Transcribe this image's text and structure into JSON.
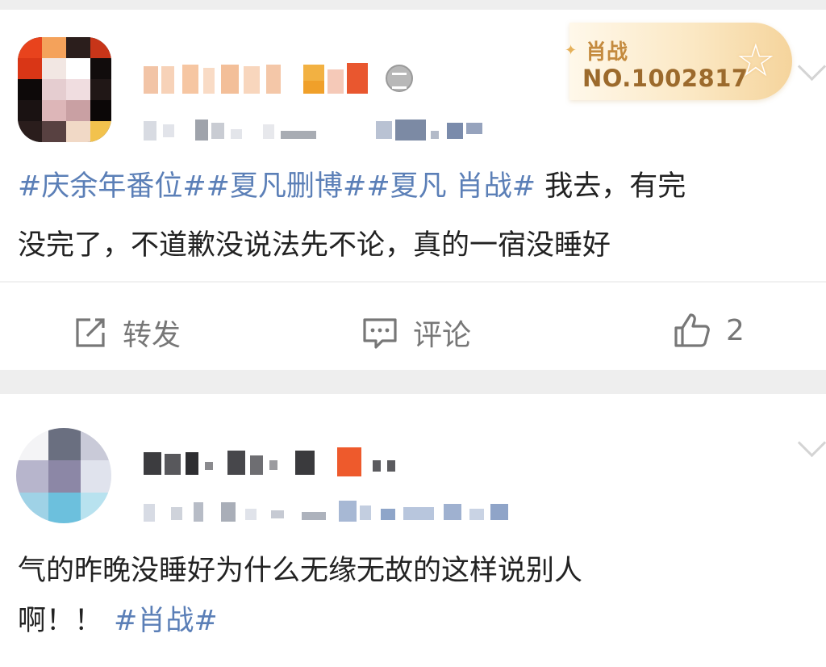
{
  "posts": [
    {
      "badge": {
        "name": "肖战",
        "number": "NO.1002817"
      },
      "text": {
        "tags": [
          "#庆余年番位#",
          "#夏凡删博#",
          "#夏凡 肖战#"
        ],
        "line1_rest": " 我去，有完",
        "line2": "没完了，不道歉没说法先不论，真的一宿没睡好"
      },
      "actions": {
        "repost": "转发",
        "comment": "评论",
        "likes": "2"
      }
    },
    {
      "text": {
        "line1": "气的昨晚没睡好为什么无缘无故的这样说别人",
        "line2_plain": "啊！！",
        "line2_tag": "#肖战#"
      }
    }
  ],
  "icons": [
    "avatar-icon",
    "medal-icon",
    "chevron-down-icon",
    "star-icon",
    "repost-icon",
    "comment-icon",
    "like-icon"
  ]
}
